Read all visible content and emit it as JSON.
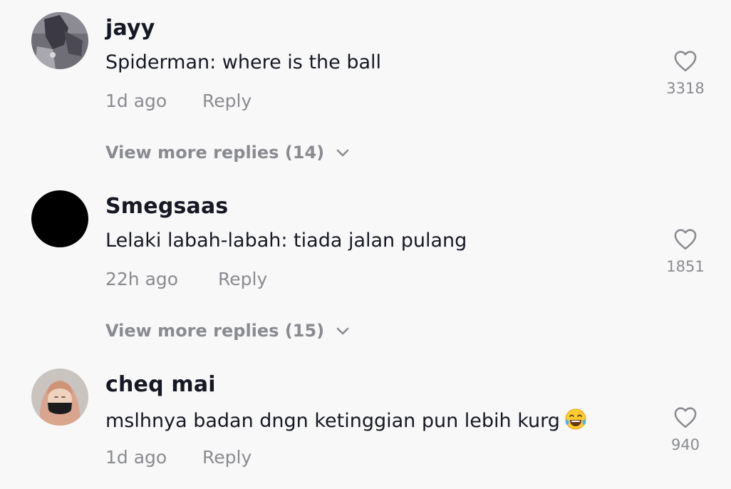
{
  "comments": [
    {
      "username": "jayy",
      "text": "Spiderman: where is the ball",
      "time": "1d ago",
      "reply_label": "Reply",
      "likes": "3318",
      "view_more": "View more replies (14)"
    },
    {
      "username": "Smegsaas",
      "text": "Lelaki labah-labah: tiada jalan pulang",
      "time": "22h ago",
      "reply_label": "Reply",
      "likes": "1851",
      "view_more": "View more replies (15)"
    },
    {
      "username": "cheq mai",
      "text": "mslhnya badan dngn ketinggian pun lebih kurg",
      "emoji": "face-with-tears-of-joy-emoji",
      "time": "1d ago",
      "reply_label": "Reply",
      "likes": "940"
    }
  ],
  "icons": {
    "like": "heart-outline-icon",
    "expand": "chevron-down-icon"
  },
  "colors": {
    "background": "#f8f8f8",
    "primary_text": "#161823",
    "secondary_text": "#8a8b91"
  }
}
